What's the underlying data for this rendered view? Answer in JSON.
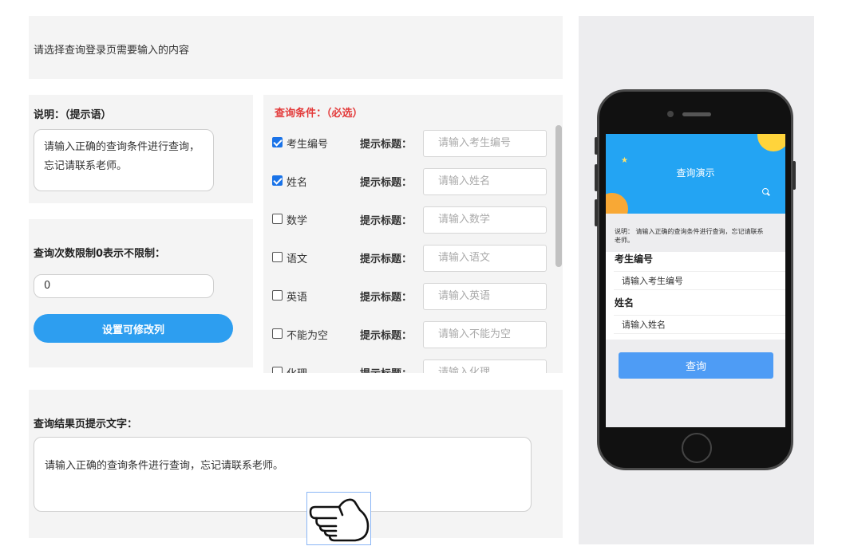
{
  "top": {
    "instruction": "请选择查询登录页需要输入的内容"
  },
  "description": {
    "title": "说明：（提示语）",
    "text": "请输入正确的查询条件进行查询，忘记请联系老师。"
  },
  "limit": {
    "title": "查询次数限制0表示不限制：",
    "value": "0",
    "button_label": "设置可修改列"
  },
  "conditions": {
    "title": "查询条件：（必选）",
    "hint_label": "提示标题：",
    "items": [
      {
        "name": "考生编号",
        "checked": true,
        "placeholder": "请输入考生编号"
      },
      {
        "name": "姓名",
        "checked": true,
        "placeholder": "请输入姓名"
      },
      {
        "name": "数学",
        "checked": false,
        "placeholder": "请输入数学"
      },
      {
        "name": "语文",
        "checked": false,
        "placeholder": "请输入语文"
      },
      {
        "name": "英语",
        "checked": false,
        "placeholder": "请输入英语"
      },
      {
        "name": "不能为空",
        "checked": false,
        "placeholder": "请输入不能为空"
      },
      {
        "name": "化理",
        "checked": false,
        "placeholder": "请输入化理"
      }
    ]
  },
  "result": {
    "title": "查询结果页提示文字：",
    "text": "请输入正确的查询条件进行查询，忘记请联系老师。"
  },
  "preview": {
    "header_title": "查询演示",
    "note": "说明： 请输入正确的查询条件进行查询，忘记请联系老师。",
    "fields": [
      {
        "label": "考生编号",
        "placeholder": "请输入考生编号"
      },
      {
        "label": "姓名",
        "placeholder": "请输入姓名"
      }
    ],
    "button_label": "查询"
  },
  "icons": {
    "pointer": "hand-pointer-icon",
    "star": "star-icon",
    "search": "search-icon"
  },
  "colors": {
    "accent": "#2d9ef0",
    "required_title": "#e33b3b",
    "preview_header": "#23a4f3",
    "preview_button": "#4e9cf5"
  }
}
